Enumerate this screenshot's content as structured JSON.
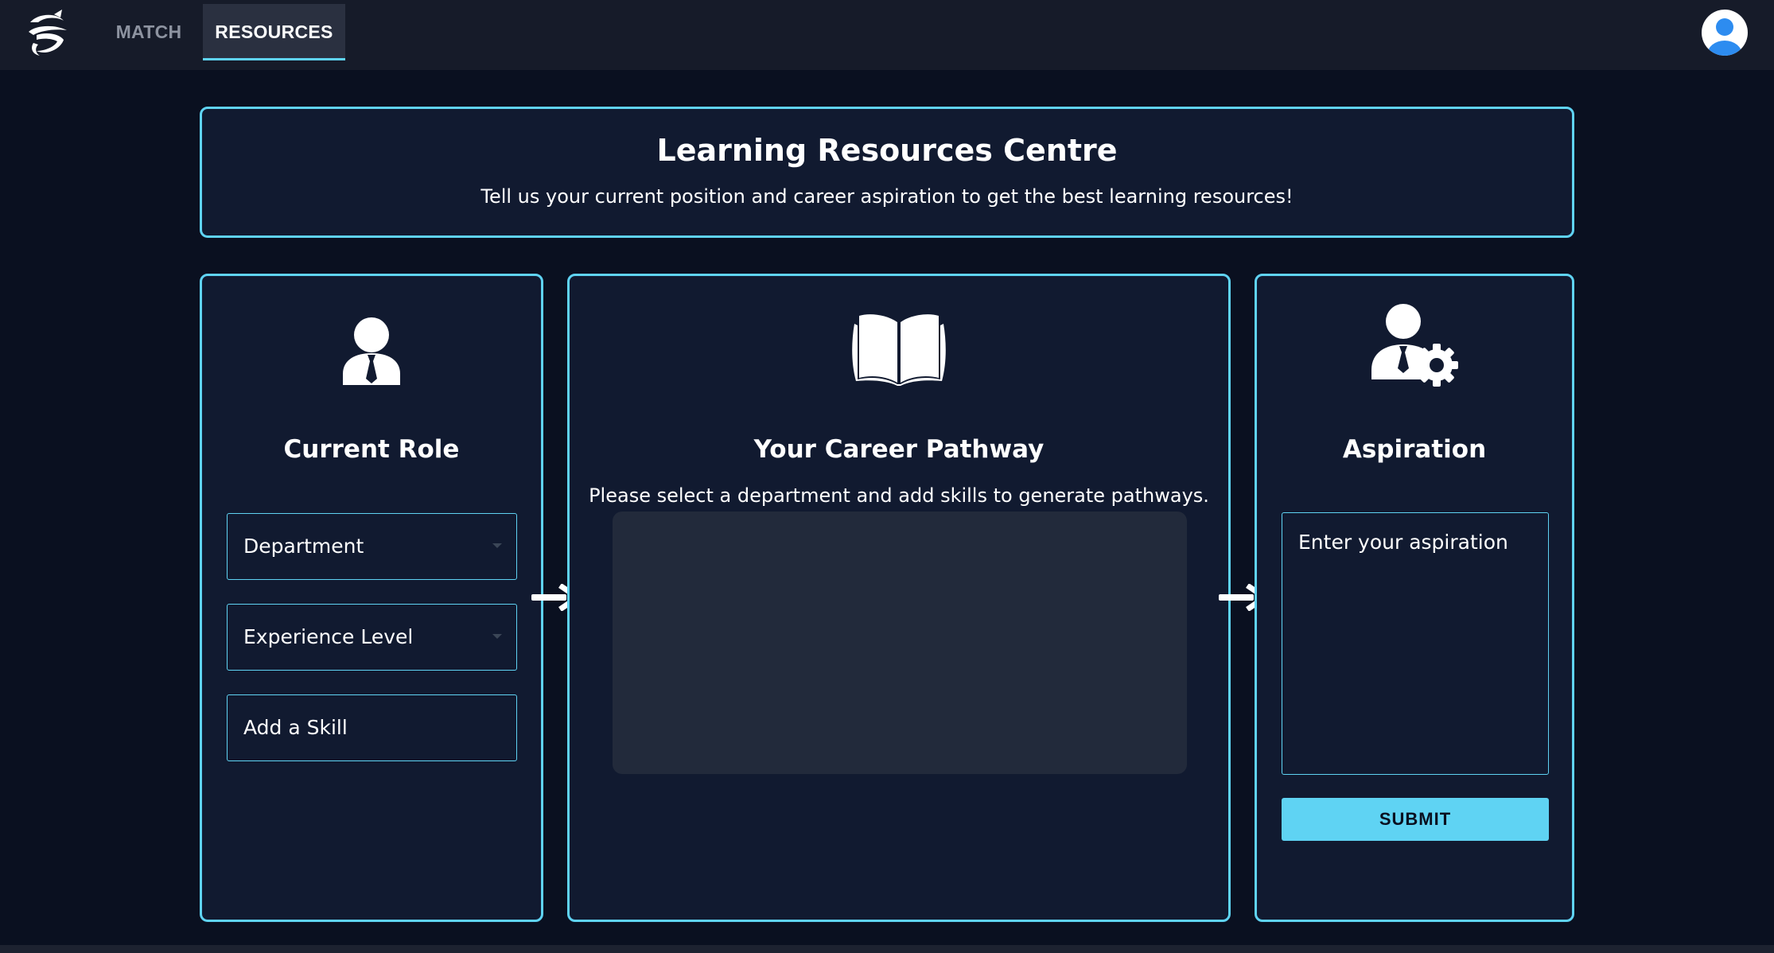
{
  "nav": {
    "logo_icon": "brand-logo-icon",
    "tabs": [
      {
        "label": "MATCH",
        "active": false
      },
      {
        "label": "RESOURCES",
        "active": true
      }
    ],
    "avatar_icon": "user-avatar-icon"
  },
  "header": {
    "title": "Learning Resources Centre",
    "subtitle": "Tell us your current position and career aspiration to get the best learning resources!"
  },
  "current_role": {
    "icon": "person-tie-icon",
    "title": "Current Role",
    "department_placeholder": "Department",
    "experience_placeholder": "Experience Level",
    "skill_placeholder": "Add a Skill"
  },
  "pathway": {
    "icon": "open-book-icon",
    "title": "Your Career Pathway",
    "note": "Please select a department and add skills to generate pathways."
  },
  "aspiration": {
    "icon": "person-gear-icon",
    "title": "Aspiration",
    "placeholder": "Enter your aspiration",
    "submit_label": "SUBMIT"
  },
  "colors": {
    "accent": "#5fd3f3",
    "background": "#0a1020",
    "panel": "#111a30",
    "navbar": "#161b29"
  }
}
